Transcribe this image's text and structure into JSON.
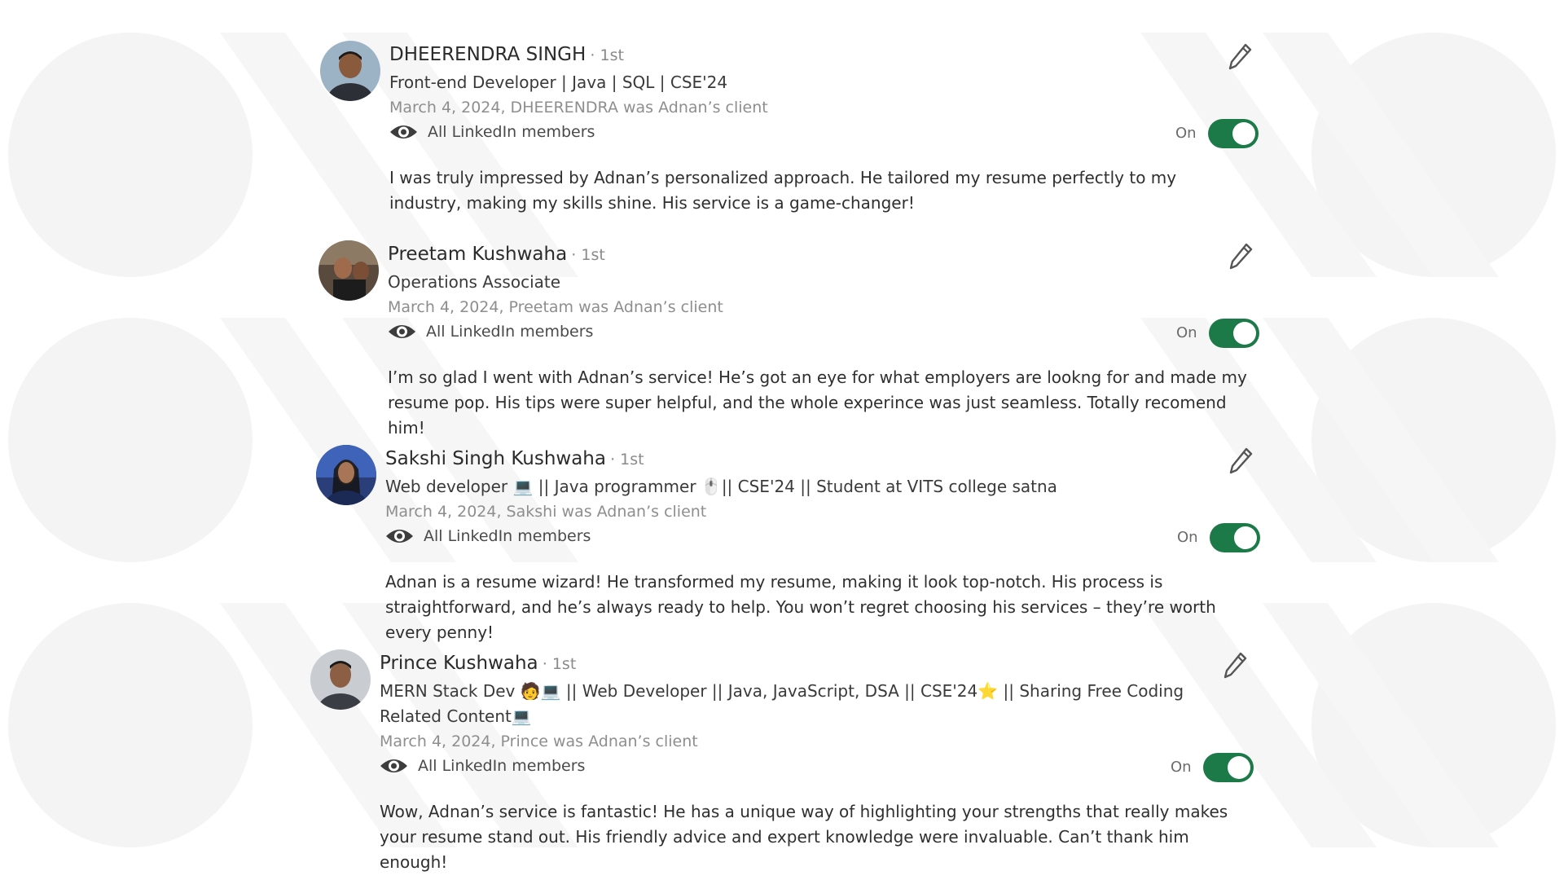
{
  "recommendations": [
    {
      "name": "DHEERENDRA SINGH",
      "degree": "· 1st",
      "headline": "Front-end Developer | Java | SQL | CSE'24",
      "meta": "March 4, 2024, DHEERENDRA was Adnan’s client",
      "visibility": "All LinkedIn members",
      "toggle_label": "On",
      "text": "I was truly impressed by Adnan’s personalized approach. He tailored my resume perfectly to my industry, making my skills shine. His service is a game-changer!"
    },
    {
      "name": "Preetam Kushwaha",
      "degree": "· 1st",
      "headline": "Operations Associate",
      "meta": "March 4, 2024, Preetam was Adnan’s client",
      "visibility": "All LinkedIn members",
      "toggle_label": "On",
      "text": "I’m so glad I went with Adnan’s service! He’s got an eye for what employers are lookng for and made my resume pop. His tips were super helpful, and the whole experince was just seamless. Totally recomend him!"
    },
    {
      "name": "Sakshi Singh Kushwaha",
      "degree": "· 1st",
      "headline": "Web developer 💻 || Java programmer 🖱️|| CSE'24 || Student at VITS college satna",
      "meta": "March 4, 2024, Sakshi was Adnan’s client",
      "visibility": "All LinkedIn members",
      "toggle_label": "On",
      "text": "Adnan is a resume wizard! He transformed my resume, making it look top-notch. His process is straightforward, and he’s always ready to help. You won’t regret choosing his services – they’re worth every penny!"
    },
    {
      "name": "Prince Kushwaha",
      "degree": "· 1st",
      "headline": "MERN Stack Dev 🧑💻 || Web Developer || Java, JavaScript, DSA || CSE'24⭐ || Sharing Free Coding Related Content💻",
      "meta": "March 4, 2024, Prince was Adnan’s client",
      "visibility": "All LinkedIn members",
      "toggle_label": "On",
      "text": "Wow, Adnan’s service is fantastic! He has a unique way of highlighting your strengths that really makes your resume stand out. His friendly advice and expert knowledge were invaluable. Can’t thank him enough!"
    }
  ],
  "colors": {
    "toggle_on": "#1b7a47",
    "name_text": "#2b2b2b",
    "meta_text": "#8e8e8e",
    "watermark": "#f4f4f4"
  },
  "icons": {
    "edit": "pencil-icon",
    "visibility": "eye-icon"
  }
}
